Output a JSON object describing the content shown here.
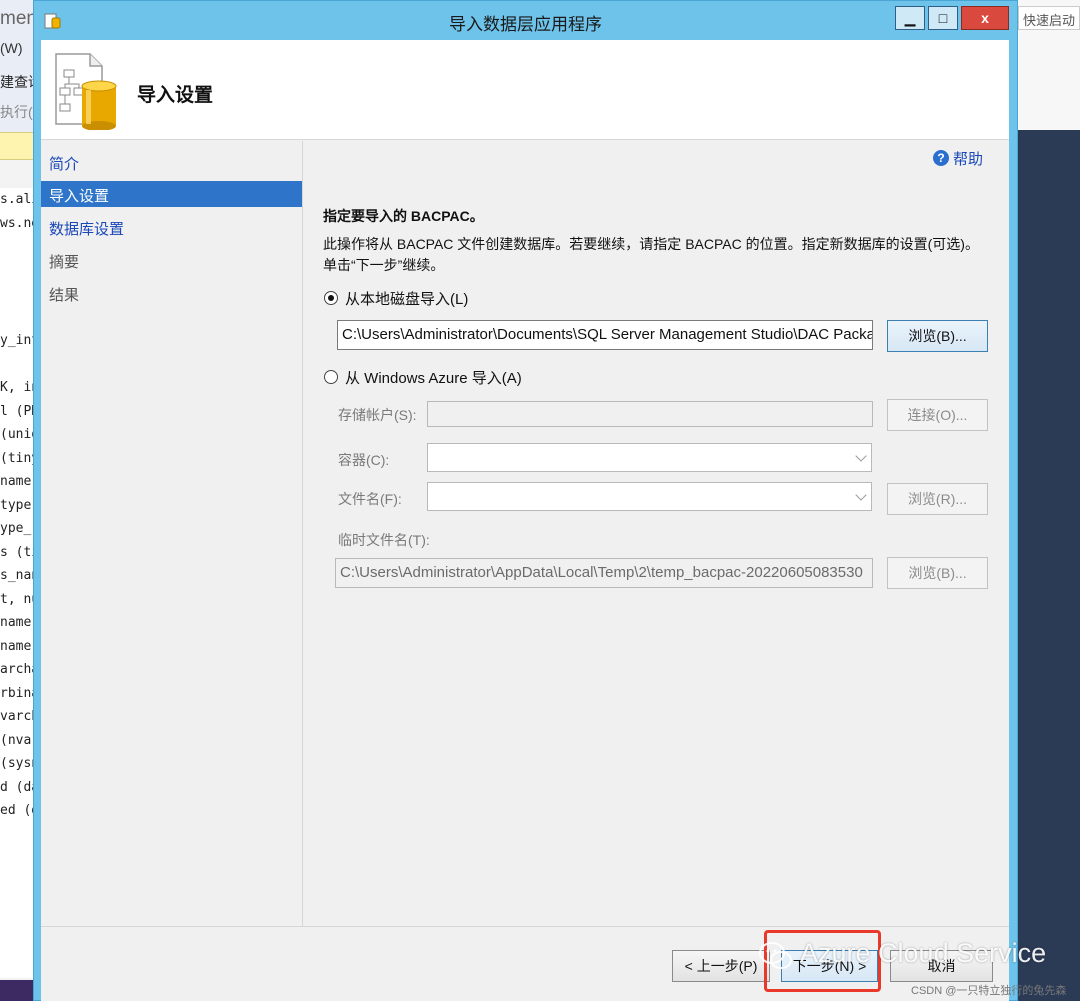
{
  "background_app": {
    "title_fragment": "ment",
    "menu_fragment": "(W)",
    "query_fragment": "建查询",
    "execute_fragment": "执行(X)",
    "quick_launch": "快速启动",
    "code_fragments": [
      "s.aliy",
      "ws.ne",
      "",
      "",
      "",
      "",
      "y_inte",
      "",
      "K, int,",
      "l (PK,",
      "(uniq",
      "(tinyi",
      "name",
      "type",
      "ype_",
      "s (tin",
      "s_nan",
      "t, nul",
      "name",
      "name",
      "archa",
      "rbina",
      "varch",
      "(nva",
      "(sysn",
      "d (da",
      "ed (d"
    ]
  },
  "dialog": {
    "title": "导入数据层应用程序",
    "window_buttons": {
      "minimize": "▁",
      "maximize": "□",
      "close": "x"
    },
    "header_title": "导入设置",
    "nav": [
      {
        "label": "简介",
        "state": "link"
      },
      {
        "label": "导入设置",
        "state": "active"
      },
      {
        "label": "数据库设置",
        "state": "link"
      },
      {
        "label": "摘要",
        "state": "disabled"
      },
      {
        "label": "结果",
        "state": "disabled"
      }
    ],
    "help": {
      "icon": "help-circle-icon",
      "label": "帮助"
    },
    "section_heading": "指定要导入的 BACPAC。",
    "description_line1": "此操作将从 BACPAC 文件创建数据库。若要继续，请指定 BACPAC 的位置。指定新数据库的设置(可选)。",
    "description_line2": "单击“下一步”继续。",
    "local_disk": {
      "label": "从本地磁盘导入(L)",
      "selected": true,
      "path_value": "C:\\Users\\Administrator\\Documents\\SQL Server Management Studio\\DAC Packages\\",
      "browse_label": "浏览(B)..."
    },
    "azure": {
      "label": "从 Windows Azure 导入(A)",
      "selected": false,
      "storage_account_label": "存储帐户(S):",
      "storage_account_value": "",
      "connect_label": "连接(O)...",
      "container_label": "容器(C):",
      "container_value": "",
      "filename_label": "文件名(F):",
      "filename_value": "",
      "filename_browse_label": "浏览(R)...",
      "temp_filename_label": "临时文件名(T):",
      "temp_filename_value": "C:\\Users\\Administrator\\AppData\\Local\\Temp\\2\\temp_bacpac-20220605083530",
      "temp_browse_label": "浏览(B)..."
    },
    "footer": {
      "prev_label": "< 上一步(P)",
      "next_label": "下一步(N) >",
      "cancel_label": "取消"
    }
  },
  "overlays": {
    "highlight_color": "#e8392b",
    "watermark_text": "Azure Cloud Service",
    "csdn_credit": "CSDN @一只特立独行的兔先森"
  }
}
